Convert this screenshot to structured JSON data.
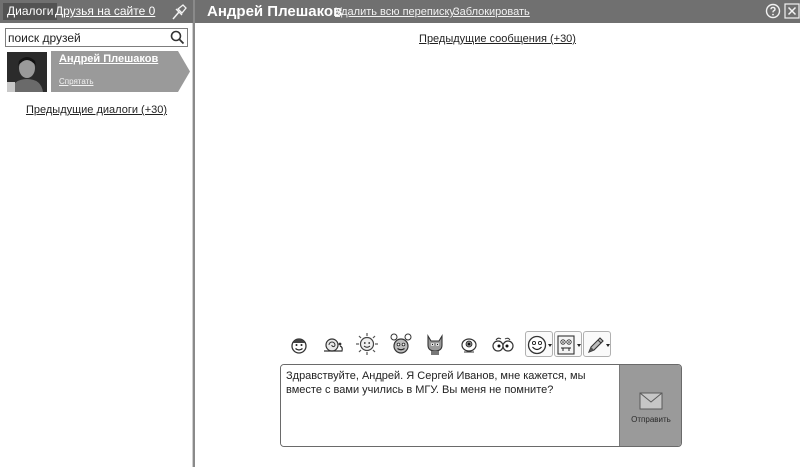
{
  "sidebar": {
    "tab_dialogs": "Диалоги",
    "tab_friends": "Друзья на сайте 0",
    "search_placeholder": "поиск друзей",
    "dialogs": [
      {
        "name": "Андрей Плешаков",
        "hide_label": "Спрятать"
      }
    ],
    "prev_dialogs": "Предыдущие диалоги (+30)"
  },
  "header": {
    "contact_name": "Андрей Плешаков",
    "delete_all": "Удалить всю переписку",
    "block": "Заблокировать"
  },
  "chat": {
    "prev_messages": "Предыдущие сообщения (+30)",
    "draft": "Здравствуйте, Андрей. Я Сергей Иванов, мне кажется, мы вместе с вами учились в МГУ. Вы меня не помните?",
    "send_label": "Отправить"
  },
  "toolbar": {
    "icons": [
      "smiley-icon",
      "snail-icon",
      "sun-icon",
      "monster-icon",
      "cat-icon",
      "eyeball-icon",
      "glasses-icon",
      "emoji-dropdown",
      "sticker-dropdown",
      "pencil-dropdown"
    ]
  },
  "colors": {
    "bar": "#707070",
    "active_tab": "#535353",
    "send_button": "#9a9a9a"
  }
}
